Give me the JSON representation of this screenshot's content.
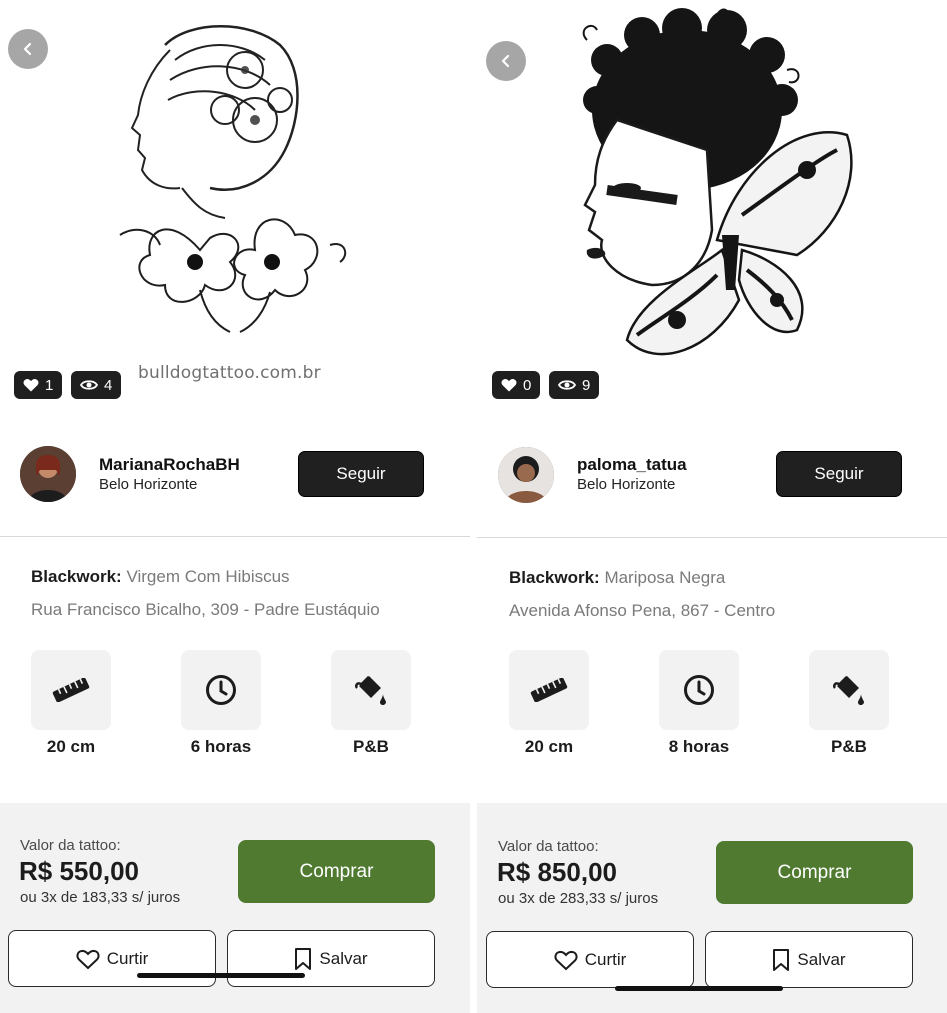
{
  "panels": [
    {
      "watermark": "bulldogtattoo.com.br",
      "likes": "1",
      "views": "4",
      "artist": {
        "name": "MarianaRochaBH",
        "city": "Belo Horizonte",
        "follow_label": "Seguir"
      },
      "style_label": "Blackwork:",
      "title": "Virgem Com Hibiscus",
      "address": "Rua Francisco Bicalho, 309 - Padre Eustáquio",
      "features": [
        {
          "icon": "ruler-icon",
          "label": "20 cm"
        },
        {
          "icon": "clock-icon",
          "label": "6 horas"
        },
        {
          "icon": "paint-bucket-icon",
          "label": "P&B"
        }
      ],
      "price_caption": "Valor da tattoo:",
      "price": "R$ 550,00",
      "installments": "ou 3x de 183,33 s/ juros",
      "buy_label": "Comprar",
      "like_label": "Curtir",
      "save_label": "Salvar"
    },
    {
      "watermark": "",
      "likes": "0",
      "views": "9",
      "artist": {
        "name": "paloma_tatua",
        "city": "Belo Horizonte",
        "follow_label": "Seguir"
      },
      "style_label": "Blackwork:",
      "title": "Mariposa Negra",
      "address": "Avenida Afonso Pena, 867 - Centro",
      "features": [
        {
          "icon": "ruler-icon",
          "label": "20 cm"
        },
        {
          "icon": "clock-icon",
          "label": "8 horas"
        },
        {
          "icon": "paint-bucket-icon",
          "label": "P&B"
        }
      ],
      "price_caption": "Valor da tattoo:",
      "price": "R$ 850,00",
      "installments": "ou 3x de 283,33 s/ juros",
      "buy_label": "Comprar",
      "like_label": "Curtir",
      "save_label": "Salvar"
    }
  ],
  "colors": {
    "buy_button": "#4f7a30",
    "follow_button": "#202020",
    "stat_badge": "#1f1f1f",
    "feature_tile": "#f2f2f2",
    "buy_area": "#f2f2f2"
  }
}
